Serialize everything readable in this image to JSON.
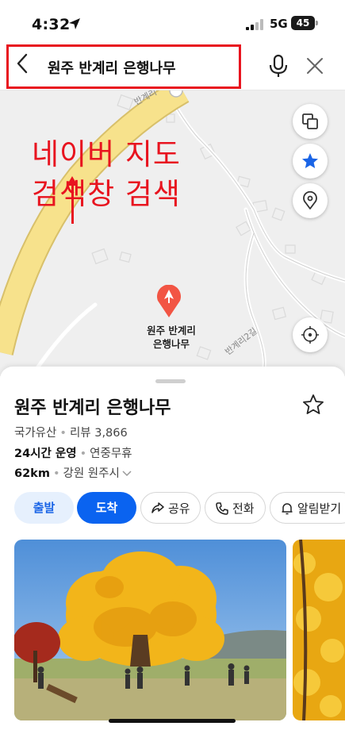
{
  "status_bar": {
    "time": "4:32",
    "network": "5G",
    "battery": "45"
  },
  "search": {
    "query": "원주 반계리 은행나무"
  },
  "annotation": {
    "line1": "네이버 지도",
    "line2": "검색창 검색"
  },
  "map": {
    "pin_label_line1": "원주 반계리",
    "pin_label_line2": "은행나무",
    "road_label_1": "반계리",
    "road_label_2": "반계리2길"
  },
  "place": {
    "title": "원주 반계리 은행나무",
    "category": "국가유산",
    "review_label": "리뷰 3,866",
    "hours": "24시간 운영",
    "hours_note": "연중무휴",
    "distance": "62km",
    "region": "강원 원주시"
  },
  "actions": {
    "depart": "출발",
    "arrive": "도착",
    "share": "공유",
    "call": "전화",
    "notify": "알림받기"
  },
  "colors": {
    "accent_red": "#e8141f",
    "primary_blue": "#0a63f0",
    "light_blue_bg": "#e6f0fd",
    "ginkgo_yellow": "#f2b51a"
  }
}
